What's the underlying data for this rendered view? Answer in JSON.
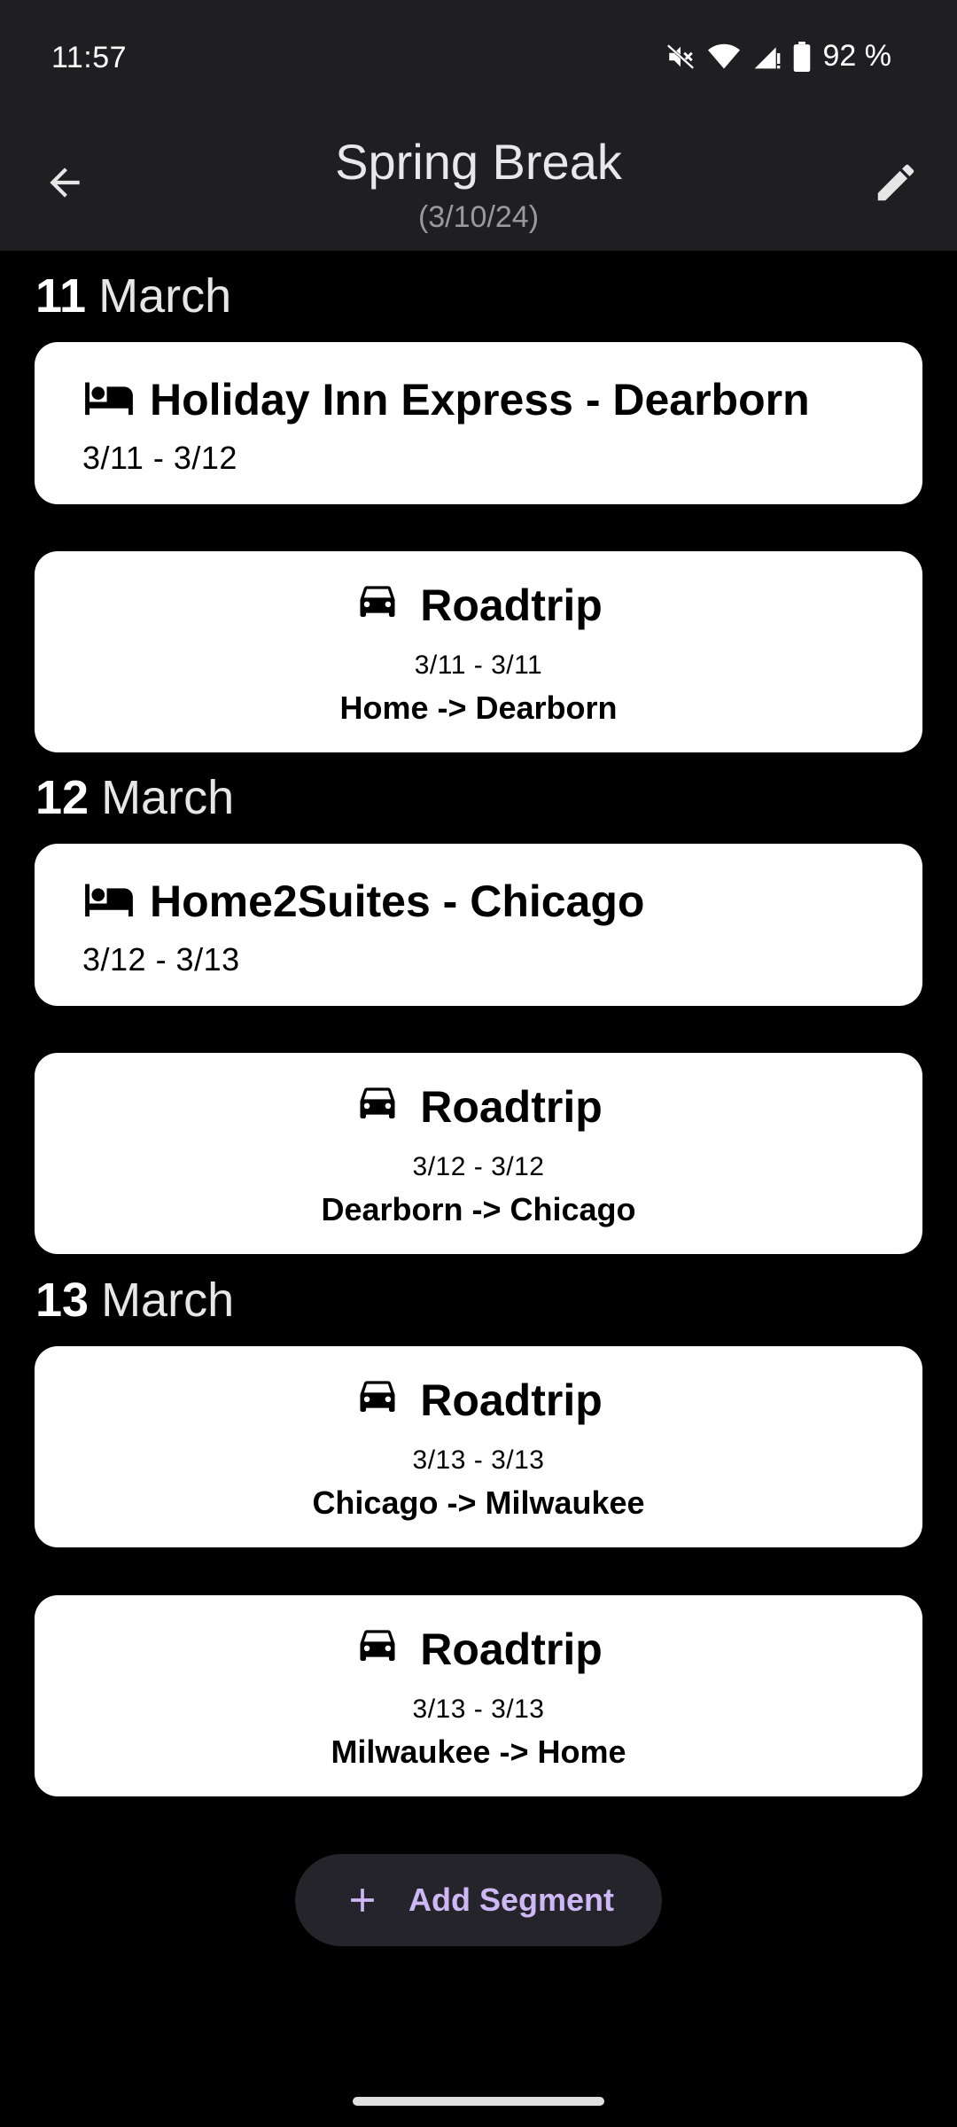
{
  "status_bar": {
    "time": "11:57",
    "battery": "92 %",
    "icons": [
      "mute-icon",
      "wifi-icon",
      "signal-icon",
      "battery-icon"
    ]
  },
  "app_bar": {
    "title": "Spring Break",
    "subtitle": "(3/10/24)",
    "back_icon": "arrow-back-icon",
    "edit_icon": "pencil-icon"
  },
  "days": [
    {
      "day": "11",
      "month": "March",
      "segments": [
        {
          "type": "lodging",
          "icon": "bed-icon",
          "title": "Holiday Inn Express - Dearborn",
          "dates": "3/11 - 3/12"
        },
        {
          "type": "roadtrip",
          "icon": "car-icon",
          "title": "Roadtrip",
          "dates": "3/11 - 3/11",
          "route": "Home -> Dearborn"
        }
      ]
    },
    {
      "day": "12",
      "month": "March",
      "segments": [
        {
          "type": "lodging",
          "icon": "bed-icon",
          "title": "Home2Suites - Chicago",
          "dates": "3/12 - 3/13"
        },
        {
          "type": "roadtrip",
          "icon": "car-icon",
          "title": "Roadtrip",
          "dates": "3/12 - 3/12",
          "route": "Dearborn -> Chicago"
        }
      ]
    },
    {
      "day": "13",
      "month": "March",
      "segments": [
        {
          "type": "roadtrip",
          "icon": "car-icon",
          "title": "Roadtrip",
          "dates": "3/13 - 3/13",
          "route": "Chicago -> Milwaukee"
        },
        {
          "type": "roadtrip",
          "icon": "car-icon",
          "title": "Roadtrip",
          "dates": "3/13 - 3/13",
          "route": "Milwaukee -> Home"
        }
      ]
    }
  ],
  "add_segment": {
    "label": "Add Segment",
    "icon": "plus-icon"
  },
  "colors": {
    "background": "#000000",
    "app_bar": "#1f1f21",
    "card": "#ffffff",
    "accent": "#cdb8f5",
    "button_bg": "#26242b"
  }
}
